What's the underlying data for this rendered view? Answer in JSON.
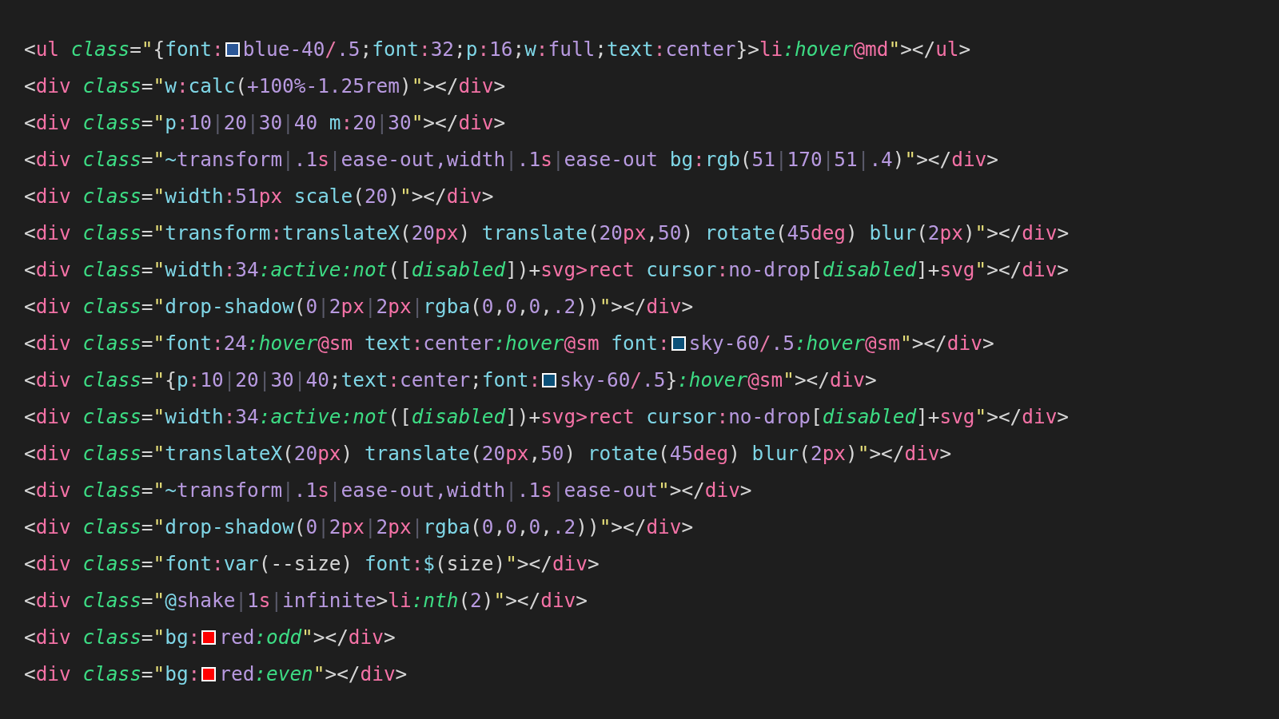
{
  "lines": [
    [
      {
        "kind": "p",
        "t": "<"
      },
      {
        "kind": "tag",
        "t": "ul"
      },
      {
        "kind": "attr",
        "t": "class",
        "gap": true
      },
      {
        "kind": "p",
        "t": "="
      },
      {
        "kind": "q",
        "t": "\""
      },
      {
        "kind": "p",
        "t": "{"
      },
      {
        "kind": "prop",
        "t": "font"
      },
      {
        "kind": "op",
        "t": ":"
      },
      {
        "kind": "sw",
        "color": "#2b5797"
      },
      {
        "kind": "val",
        "t": "blue-40"
      },
      {
        "kind": "op",
        "t": "/"
      },
      {
        "kind": "val",
        "t": ".5"
      },
      {
        "kind": "p",
        "t": ";"
      },
      {
        "kind": "prop",
        "t": "font"
      },
      {
        "kind": "op",
        "t": ":"
      },
      {
        "kind": "val",
        "t": "32"
      },
      {
        "kind": "p",
        "t": ";"
      },
      {
        "kind": "prop",
        "t": "p"
      },
      {
        "kind": "op",
        "t": ":"
      },
      {
        "kind": "val",
        "t": "16"
      },
      {
        "kind": "p",
        "t": ";"
      },
      {
        "kind": "prop",
        "t": "w"
      },
      {
        "kind": "op",
        "t": ":"
      },
      {
        "kind": "val",
        "t": "full"
      },
      {
        "kind": "p",
        "t": ";"
      },
      {
        "kind": "prop",
        "t": "text"
      },
      {
        "kind": "op",
        "t": ":"
      },
      {
        "kind": "val",
        "t": "center"
      },
      {
        "kind": "p",
        "t": "}>"
      },
      {
        "kind": "tag",
        "t": "li"
      },
      {
        "kind": "it",
        "t": ":hover"
      },
      {
        "kind": "tag",
        "t": "@md"
      },
      {
        "kind": "q",
        "t": "\""
      },
      {
        "kind": "p",
        "t": "></"
      },
      {
        "kind": "tag",
        "t": "ul"
      },
      {
        "kind": "p",
        "t": ">"
      }
    ],
    [
      {
        "kind": "p",
        "t": "<"
      },
      {
        "kind": "tag",
        "t": "div"
      },
      {
        "kind": "attr",
        "t": "class",
        "gap": true
      },
      {
        "kind": "p",
        "t": "="
      },
      {
        "kind": "q",
        "t": "\""
      },
      {
        "kind": "prop",
        "t": "w"
      },
      {
        "kind": "op",
        "t": ":"
      },
      {
        "kind": "prop",
        "t": "calc"
      },
      {
        "kind": "p",
        "t": "("
      },
      {
        "kind": "val",
        "t": "+100%-1.25rem"
      },
      {
        "kind": "p",
        "t": ")"
      },
      {
        "kind": "q",
        "t": "\""
      },
      {
        "kind": "p",
        "t": "></"
      },
      {
        "kind": "tag",
        "t": "div"
      },
      {
        "kind": "p",
        "t": ">"
      }
    ],
    [
      {
        "kind": "p",
        "t": "<"
      },
      {
        "kind": "tag",
        "t": "div"
      },
      {
        "kind": "attr",
        "t": "class",
        "gap": true
      },
      {
        "kind": "p",
        "t": "="
      },
      {
        "kind": "q",
        "t": "\""
      },
      {
        "kind": "prop",
        "t": "p"
      },
      {
        "kind": "op",
        "t": ":"
      },
      {
        "kind": "val",
        "t": "10"
      },
      {
        "kind": "bar",
        "t": "|"
      },
      {
        "kind": "val",
        "t": "20"
      },
      {
        "kind": "bar",
        "t": "|"
      },
      {
        "kind": "val",
        "t": "30"
      },
      {
        "kind": "bar",
        "t": "|"
      },
      {
        "kind": "val",
        "t": "40"
      },
      {
        "kind": "prop",
        "t": "m",
        "gap": true
      },
      {
        "kind": "op",
        "t": ":"
      },
      {
        "kind": "val",
        "t": "20"
      },
      {
        "kind": "bar",
        "t": "|"
      },
      {
        "kind": "val",
        "t": "30"
      },
      {
        "kind": "q",
        "t": "\""
      },
      {
        "kind": "p",
        "t": "></"
      },
      {
        "kind": "tag",
        "t": "div"
      },
      {
        "kind": "p",
        "t": ">"
      }
    ],
    [
      {
        "kind": "p",
        "t": "<"
      },
      {
        "kind": "tag",
        "t": "div"
      },
      {
        "kind": "attr",
        "t": "class",
        "gap": true
      },
      {
        "kind": "p",
        "t": "="
      },
      {
        "kind": "q",
        "t": "\""
      },
      {
        "kind": "prop",
        "t": "~"
      },
      {
        "kind": "val",
        "t": "transform"
      },
      {
        "kind": "bar",
        "t": "|"
      },
      {
        "kind": "val",
        "t": ".1"
      },
      {
        "kind": "unit",
        "t": "s"
      },
      {
        "kind": "bar",
        "t": "|"
      },
      {
        "kind": "val",
        "t": "ease-out,width"
      },
      {
        "kind": "bar",
        "t": "|"
      },
      {
        "kind": "val",
        "t": ".1"
      },
      {
        "kind": "unit",
        "t": "s"
      },
      {
        "kind": "bar",
        "t": "|"
      },
      {
        "kind": "val",
        "t": "ease-out"
      },
      {
        "kind": "prop",
        "t": "bg",
        "gap": true
      },
      {
        "kind": "op",
        "t": ":"
      },
      {
        "kind": "prop",
        "t": "rgb"
      },
      {
        "kind": "p",
        "t": "("
      },
      {
        "kind": "val",
        "t": "51"
      },
      {
        "kind": "bar",
        "t": "|"
      },
      {
        "kind": "val",
        "t": "170"
      },
      {
        "kind": "bar",
        "t": "|"
      },
      {
        "kind": "val",
        "t": "51"
      },
      {
        "kind": "bar",
        "t": "|"
      },
      {
        "kind": "val",
        "t": ".4"
      },
      {
        "kind": "p",
        "t": ")"
      },
      {
        "kind": "q",
        "t": "\""
      },
      {
        "kind": "p",
        "t": "></"
      },
      {
        "kind": "tag",
        "t": "div"
      },
      {
        "kind": "p",
        "t": ">"
      }
    ],
    [
      {
        "kind": "p",
        "t": "<"
      },
      {
        "kind": "tag",
        "t": "div"
      },
      {
        "kind": "attr",
        "t": "class",
        "gap": true
      },
      {
        "kind": "p",
        "t": "="
      },
      {
        "kind": "q",
        "t": "\""
      },
      {
        "kind": "prop",
        "t": "width"
      },
      {
        "kind": "op",
        "t": ":"
      },
      {
        "kind": "val",
        "t": "51"
      },
      {
        "kind": "unit",
        "t": "px"
      },
      {
        "kind": "prop",
        "t": "scale",
        "gap": true
      },
      {
        "kind": "p",
        "t": "("
      },
      {
        "kind": "val",
        "t": "20"
      },
      {
        "kind": "p",
        "t": ")"
      },
      {
        "kind": "q",
        "t": "\""
      },
      {
        "kind": "p",
        "t": "></"
      },
      {
        "kind": "tag",
        "t": "div"
      },
      {
        "kind": "p",
        "t": ">"
      }
    ],
    [
      {
        "kind": "p",
        "t": "<"
      },
      {
        "kind": "tag",
        "t": "div"
      },
      {
        "kind": "attr",
        "t": "class",
        "gap": true
      },
      {
        "kind": "p",
        "t": "="
      },
      {
        "kind": "q",
        "t": "\""
      },
      {
        "kind": "prop",
        "t": "transform"
      },
      {
        "kind": "op",
        "t": ":"
      },
      {
        "kind": "prop",
        "t": "translateX"
      },
      {
        "kind": "p",
        "t": "("
      },
      {
        "kind": "val",
        "t": "20"
      },
      {
        "kind": "unit",
        "t": "px"
      },
      {
        "kind": "p",
        "t": ")"
      },
      {
        "kind": "prop",
        "t": "translate",
        "gap": true
      },
      {
        "kind": "p",
        "t": "("
      },
      {
        "kind": "val",
        "t": "20"
      },
      {
        "kind": "unit",
        "t": "px"
      },
      {
        "kind": "p",
        "t": ","
      },
      {
        "kind": "val",
        "t": "50"
      },
      {
        "kind": "p",
        "t": ")"
      },
      {
        "kind": "prop",
        "t": "rotate",
        "gap": true
      },
      {
        "kind": "p",
        "t": "("
      },
      {
        "kind": "val",
        "t": "45"
      },
      {
        "kind": "unit",
        "t": "deg"
      },
      {
        "kind": "p",
        "t": ")"
      },
      {
        "kind": "prop",
        "t": "blur",
        "gap": true
      },
      {
        "kind": "p",
        "t": "("
      },
      {
        "kind": "val",
        "t": "2"
      },
      {
        "kind": "unit",
        "t": "px"
      },
      {
        "kind": "p",
        "t": ")"
      },
      {
        "kind": "q",
        "t": "\""
      },
      {
        "kind": "p",
        "t": "></"
      },
      {
        "kind": "tag",
        "t": "div"
      },
      {
        "kind": "p",
        "t": ">"
      }
    ],
    [
      {
        "kind": "p",
        "t": "<"
      },
      {
        "kind": "tag",
        "t": "div"
      },
      {
        "kind": "attr",
        "t": "class",
        "gap": true
      },
      {
        "kind": "p",
        "t": "="
      },
      {
        "kind": "q",
        "t": "\""
      },
      {
        "kind": "prop",
        "t": "width"
      },
      {
        "kind": "op",
        "t": ":"
      },
      {
        "kind": "val",
        "t": "34"
      },
      {
        "kind": "it",
        "t": ":active:not"
      },
      {
        "kind": "p",
        "t": "(["
      },
      {
        "kind": "it",
        "t": "disabled"
      },
      {
        "kind": "p",
        "t": "])+"
      },
      {
        "kind": "tag",
        "t": "svg>rect"
      },
      {
        "kind": "prop",
        "t": "cursor",
        "gap": true
      },
      {
        "kind": "op",
        "t": ":"
      },
      {
        "kind": "val",
        "t": "no-drop"
      },
      {
        "kind": "p",
        "t": "["
      },
      {
        "kind": "it",
        "t": "disabled"
      },
      {
        "kind": "p",
        "t": "]+"
      },
      {
        "kind": "tag",
        "t": "svg"
      },
      {
        "kind": "q",
        "t": "\""
      },
      {
        "kind": "p",
        "t": "></"
      },
      {
        "kind": "tag",
        "t": "div"
      },
      {
        "kind": "p",
        "t": ">"
      }
    ],
    [
      {
        "kind": "p",
        "t": "<"
      },
      {
        "kind": "tag",
        "t": "div"
      },
      {
        "kind": "attr",
        "t": "class",
        "gap": true
      },
      {
        "kind": "p",
        "t": "="
      },
      {
        "kind": "q",
        "t": "\""
      },
      {
        "kind": "prop",
        "t": "drop-shadow"
      },
      {
        "kind": "p",
        "t": "("
      },
      {
        "kind": "val",
        "t": "0"
      },
      {
        "kind": "bar",
        "t": "|"
      },
      {
        "kind": "val",
        "t": "2"
      },
      {
        "kind": "unit",
        "t": "px"
      },
      {
        "kind": "bar",
        "t": "|"
      },
      {
        "kind": "val",
        "t": "2"
      },
      {
        "kind": "unit",
        "t": "px"
      },
      {
        "kind": "bar",
        "t": "|"
      },
      {
        "kind": "prop",
        "t": "rgba"
      },
      {
        "kind": "p",
        "t": "("
      },
      {
        "kind": "val",
        "t": "0"
      },
      {
        "kind": "p",
        "t": ","
      },
      {
        "kind": "val",
        "t": "0"
      },
      {
        "kind": "p",
        "t": ","
      },
      {
        "kind": "val",
        "t": "0"
      },
      {
        "kind": "p",
        "t": ","
      },
      {
        "kind": "val",
        "t": ".2"
      },
      {
        "kind": "p",
        "t": "))"
      },
      {
        "kind": "q",
        "t": "\""
      },
      {
        "kind": "p",
        "t": "></"
      },
      {
        "kind": "tag",
        "t": "div"
      },
      {
        "kind": "p",
        "t": ">"
      }
    ],
    [
      {
        "kind": "p",
        "t": "<"
      },
      {
        "kind": "tag",
        "t": "div"
      },
      {
        "kind": "attr",
        "t": "class",
        "gap": true
      },
      {
        "kind": "p",
        "t": "="
      },
      {
        "kind": "q",
        "t": "\""
      },
      {
        "kind": "prop",
        "t": "font"
      },
      {
        "kind": "op",
        "t": ":"
      },
      {
        "kind": "val",
        "t": "24"
      },
      {
        "kind": "it",
        "t": ":hover"
      },
      {
        "kind": "tag",
        "t": "@sm"
      },
      {
        "kind": "prop",
        "t": "text",
        "gap": true
      },
      {
        "kind": "op",
        "t": ":"
      },
      {
        "kind": "val",
        "t": "center"
      },
      {
        "kind": "it",
        "t": ":hover"
      },
      {
        "kind": "tag",
        "t": "@sm"
      },
      {
        "kind": "prop",
        "t": "font",
        "gap": true
      },
      {
        "kind": "op",
        "t": ":"
      },
      {
        "kind": "sw",
        "color": "#0b5078"
      },
      {
        "kind": "val",
        "t": "sky-60"
      },
      {
        "kind": "op",
        "t": "/"
      },
      {
        "kind": "val",
        "t": ".5"
      },
      {
        "kind": "it",
        "t": ":hover"
      },
      {
        "kind": "tag",
        "t": "@sm"
      },
      {
        "kind": "q",
        "t": "\""
      },
      {
        "kind": "p",
        "t": "></"
      },
      {
        "kind": "tag",
        "t": "div"
      },
      {
        "kind": "p",
        "t": ">"
      }
    ],
    [
      {
        "kind": "p",
        "t": "<"
      },
      {
        "kind": "tag",
        "t": "div"
      },
      {
        "kind": "attr",
        "t": "class",
        "gap": true
      },
      {
        "kind": "p",
        "t": "="
      },
      {
        "kind": "q",
        "t": "\""
      },
      {
        "kind": "p",
        "t": "{"
      },
      {
        "kind": "prop",
        "t": "p"
      },
      {
        "kind": "op",
        "t": ":"
      },
      {
        "kind": "val",
        "t": "10"
      },
      {
        "kind": "bar",
        "t": "|"
      },
      {
        "kind": "val",
        "t": "20"
      },
      {
        "kind": "bar",
        "t": "|"
      },
      {
        "kind": "val",
        "t": "30"
      },
      {
        "kind": "bar",
        "t": "|"
      },
      {
        "kind": "val",
        "t": "40"
      },
      {
        "kind": "p",
        "t": ";"
      },
      {
        "kind": "prop",
        "t": "text"
      },
      {
        "kind": "op",
        "t": ":"
      },
      {
        "kind": "val",
        "t": "center"
      },
      {
        "kind": "p",
        "t": ";"
      },
      {
        "kind": "prop",
        "t": "font"
      },
      {
        "kind": "op",
        "t": ":"
      },
      {
        "kind": "sw",
        "color": "#0b5078"
      },
      {
        "kind": "val",
        "t": "sky-60"
      },
      {
        "kind": "op",
        "t": "/"
      },
      {
        "kind": "val",
        "t": ".5"
      },
      {
        "kind": "p",
        "t": "}"
      },
      {
        "kind": "it",
        "t": ":hover"
      },
      {
        "kind": "tag",
        "t": "@sm"
      },
      {
        "kind": "q",
        "t": "\""
      },
      {
        "kind": "p",
        "t": "></"
      },
      {
        "kind": "tag",
        "t": "div"
      },
      {
        "kind": "p",
        "t": ">"
      }
    ],
    [
      {
        "kind": "p",
        "t": "<"
      },
      {
        "kind": "tag",
        "t": "div"
      },
      {
        "kind": "attr",
        "t": "class",
        "gap": true
      },
      {
        "kind": "p",
        "t": "="
      },
      {
        "kind": "q",
        "t": "\""
      },
      {
        "kind": "prop",
        "t": "width"
      },
      {
        "kind": "op",
        "t": ":"
      },
      {
        "kind": "val",
        "t": "34"
      },
      {
        "kind": "it",
        "t": ":active:not"
      },
      {
        "kind": "p",
        "t": "(["
      },
      {
        "kind": "it",
        "t": "disabled"
      },
      {
        "kind": "p",
        "t": "])+"
      },
      {
        "kind": "tag",
        "t": "svg>rect"
      },
      {
        "kind": "prop",
        "t": "cursor",
        "gap": true
      },
      {
        "kind": "op",
        "t": ":"
      },
      {
        "kind": "val",
        "t": "no-drop"
      },
      {
        "kind": "p",
        "t": "["
      },
      {
        "kind": "it",
        "t": "disabled"
      },
      {
        "kind": "p",
        "t": "]+"
      },
      {
        "kind": "tag",
        "t": "svg"
      },
      {
        "kind": "q",
        "t": "\""
      },
      {
        "kind": "p",
        "t": "></"
      },
      {
        "kind": "tag",
        "t": "div"
      },
      {
        "kind": "p",
        "t": ">"
      }
    ],
    [
      {
        "kind": "p",
        "t": "<"
      },
      {
        "kind": "tag",
        "t": "div"
      },
      {
        "kind": "attr",
        "t": "class",
        "gap": true
      },
      {
        "kind": "p",
        "t": "="
      },
      {
        "kind": "q",
        "t": "\""
      },
      {
        "kind": "prop",
        "t": "translateX"
      },
      {
        "kind": "p",
        "t": "("
      },
      {
        "kind": "val",
        "t": "20"
      },
      {
        "kind": "unit",
        "t": "px"
      },
      {
        "kind": "p",
        "t": ")"
      },
      {
        "kind": "prop",
        "t": "translate",
        "gap": true
      },
      {
        "kind": "p",
        "t": "("
      },
      {
        "kind": "val",
        "t": "20"
      },
      {
        "kind": "unit",
        "t": "px"
      },
      {
        "kind": "p",
        "t": ","
      },
      {
        "kind": "val",
        "t": "50"
      },
      {
        "kind": "p",
        "t": ")"
      },
      {
        "kind": "prop",
        "t": "rotate",
        "gap": true
      },
      {
        "kind": "p",
        "t": "("
      },
      {
        "kind": "val",
        "t": "45"
      },
      {
        "kind": "unit",
        "t": "deg"
      },
      {
        "kind": "p",
        "t": ")"
      },
      {
        "kind": "prop",
        "t": "blur",
        "gap": true
      },
      {
        "kind": "p",
        "t": "("
      },
      {
        "kind": "val",
        "t": "2"
      },
      {
        "kind": "unit",
        "t": "px"
      },
      {
        "kind": "p",
        "t": ")"
      },
      {
        "kind": "q",
        "t": "\""
      },
      {
        "kind": "p",
        "t": "></"
      },
      {
        "kind": "tag",
        "t": "div"
      },
      {
        "kind": "p",
        "t": ">"
      }
    ],
    [
      {
        "kind": "p",
        "t": "<"
      },
      {
        "kind": "tag",
        "t": "div"
      },
      {
        "kind": "attr",
        "t": "class",
        "gap": true
      },
      {
        "kind": "p",
        "t": "="
      },
      {
        "kind": "q",
        "t": "\""
      },
      {
        "kind": "prop",
        "t": "~"
      },
      {
        "kind": "val",
        "t": "transform"
      },
      {
        "kind": "bar",
        "t": "|"
      },
      {
        "kind": "val",
        "t": ".1"
      },
      {
        "kind": "unit",
        "t": "s"
      },
      {
        "kind": "bar",
        "t": "|"
      },
      {
        "kind": "val",
        "t": "ease-out,width"
      },
      {
        "kind": "bar",
        "t": "|"
      },
      {
        "kind": "val",
        "t": ".1"
      },
      {
        "kind": "unit",
        "t": "s"
      },
      {
        "kind": "bar",
        "t": "|"
      },
      {
        "kind": "val",
        "t": "ease-out"
      },
      {
        "kind": "q",
        "t": "\""
      },
      {
        "kind": "p",
        "t": "></"
      },
      {
        "kind": "tag",
        "t": "div"
      },
      {
        "kind": "p",
        "t": ">"
      }
    ],
    [
      {
        "kind": "p",
        "t": "<"
      },
      {
        "kind": "tag",
        "t": "div"
      },
      {
        "kind": "attr",
        "t": "class",
        "gap": true
      },
      {
        "kind": "p",
        "t": "="
      },
      {
        "kind": "q",
        "t": "\""
      },
      {
        "kind": "prop",
        "t": "drop-shadow"
      },
      {
        "kind": "p",
        "t": "("
      },
      {
        "kind": "val",
        "t": "0"
      },
      {
        "kind": "bar",
        "t": "|"
      },
      {
        "kind": "val",
        "t": "2"
      },
      {
        "kind": "unit",
        "t": "px"
      },
      {
        "kind": "bar",
        "t": "|"
      },
      {
        "kind": "val",
        "t": "2"
      },
      {
        "kind": "unit",
        "t": "px"
      },
      {
        "kind": "bar",
        "t": "|"
      },
      {
        "kind": "prop",
        "t": "rgba"
      },
      {
        "kind": "p",
        "t": "("
      },
      {
        "kind": "val",
        "t": "0"
      },
      {
        "kind": "p",
        "t": ","
      },
      {
        "kind": "val",
        "t": "0"
      },
      {
        "kind": "p",
        "t": ","
      },
      {
        "kind": "val",
        "t": "0"
      },
      {
        "kind": "p",
        "t": ","
      },
      {
        "kind": "val",
        "t": ".2"
      },
      {
        "kind": "p",
        "t": "))"
      },
      {
        "kind": "q",
        "t": "\""
      },
      {
        "kind": "p",
        "t": "></"
      },
      {
        "kind": "tag",
        "t": "div"
      },
      {
        "kind": "p",
        "t": ">"
      }
    ],
    [
      {
        "kind": "p",
        "t": "<"
      },
      {
        "kind": "tag",
        "t": "div"
      },
      {
        "kind": "attr",
        "t": "class",
        "gap": true
      },
      {
        "kind": "p",
        "t": "="
      },
      {
        "kind": "q",
        "t": "\""
      },
      {
        "kind": "prop",
        "t": "font"
      },
      {
        "kind": "op",
        "t": ":"
      },
      {
        "kind": "prop",
        "t": "var"
      },
      {
        "kind": "p",
        "t": "(--size)"
      },
      {
        "kind": "prop",
        "t": "font",
        "gap": true
      },
      {
        "kind": "op",
        "t": ":"
      },
      {
        "kind": "prop",
        "t": "$"
      },
      {
        "kind": "p",
        "t": "(size)"
      },
      {
        "kind": "q",
        "t": "\""
      },
      {
        "kind": "p",
        "t": "></"
      },
      {
        "kind": "tag",
        "t": "div"
      },
      {
        "kind": "p",
        "t": ">"
      }
    ],
    [
      {
        "kind": "p",
        "t": "<"
      },
      {
        "kind": "tag",
        "t": "div"
      },
      {
        "kind": "attr",
        "t": "class",
        "gap": true
      },
      {
        "kind": "p",
        "t": "="
      },
      {
        "kind": "q",
        "t": "\""
      },
      {
        "kind": "prop",
        "t": "@"
      },
      {
        "kind": "val",
        "t": "shake"
      },
      {
        "kind": "bar",
        "t": "|"
      },
      {
        "kind": "val",
        "t": "1"
      },
      {
        "kind": "unit",
        "t": "s"
      },
      {
        "kind": "bar",
        "t": "|"
      },
      {
        "kind": "val",
        "t": "infinite"
      },
      {
        "kind": "p",
        "t": ">"
      },
      {
        "kind": "tag",
        "t": "li"
      },
      {
        "kind": "it",
        "t": ":nth"
      },
      {
        "kind": "p",
        "t": "("
      },
      {
        "kind": "val",
        "t": "2"
      },
      {
        "kind": "p",
        "t": ")"
      },
      {
        "kind": "q",
        "t": "\""
      },
      {
        "kind": "p",
        "t": "></"
      },
      {
        "kind": "tag",
        "t": "div"
      },
      {
        "kind": "p",
        "t": ">"
      }
    ],
    [
      {
        "kind": "p",
        "t": "<"
      },
      {
        "kind": "tag",
        "t": "div"
      },
      {
        "kind": "attr",
        "t": "class",
        "gap": true
      },
      {
        "kind": "p",
        "t": "="
      },
      {
        "kind": "q",
        "t": "\""
      },
      {
        "kind": "prop",
        "t": "bg"
      },
      {
        "kind": "op",
        "t": ":"
      },
      {
        "kind": "sw",
        "color": "#ff0000"
      },
      {
        "kind": "val",
        "t": "red"
      },
      {
        "kind": "it",
        "t": ":odd"
      },
      {
        "kind": "q",
        "t": "\""
      },
      {
        "kind": "p",
        "t": "></"
      },
      {
        "kind": "tag",
        "t": "div"
      },
      {
        "kind": "p",
        "t": ">"
      }
    ],
    [
      {
        "kind": "p",
        "t": "<"
      },
      {
        "kind": "tag",
        "t": "div"
      },
      {
        "kind": "attr",
        "t": "class",
        "gap": true
      },
      {
        "kind": "p",
        "t": "="
      },
      {
        "kind": "q",
        "t": "\""
      },
      {
        "kind": "prop",
        "t": "bg"
      },
      {
        "kind": "op",
        "t": ":"
      },
      {
        "kind": "sw",
        "color": "#ff0000"
      },
      {
        "kind": "val",
        "t": "red"
      },
      {
        "kind": "it",
        "t": ":even"
      },
      {
        "kind": "q",
        "t": "\""
      },
      {
        "kind": "p",
        "t": "></"
      },
      {
        "kind": "tag",
        "t": "div"
      },
      {
        "kind": "p",
        "t": ">"
      }
    ]
  ]
}
